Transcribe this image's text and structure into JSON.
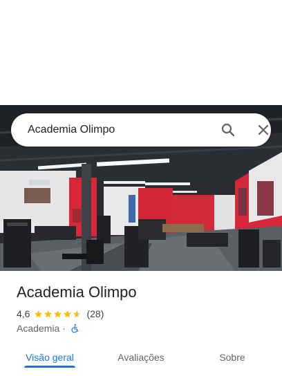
{
  "search": {
    "query": "Academia Olimpo"
  },
  "place": {
    "name": "Academia Olimpo",
    "rating": "4,6",
    "stars": 4.6,
    "reviews_count": "(28)",
    "category": "Academia",
    "separator": "·"
  },
  "tabs": [
    {
      "label": "Visão geral",
      "active": true
    },
    {
      "label": "Avaliações",
      "active": false
    },
    {
      "label": "Sobre",
      "active": false
    }
  ],
  "colors": {
    "accent": "#1a73e8",
    "star": "#fbbc04",
    "gym_wall_red": "#d6283a"
  },
  "icons": {
    "search": "search-icon",
    "close": "close-icon",
    "accessibility": "wheelchair-icon"
  }
}
